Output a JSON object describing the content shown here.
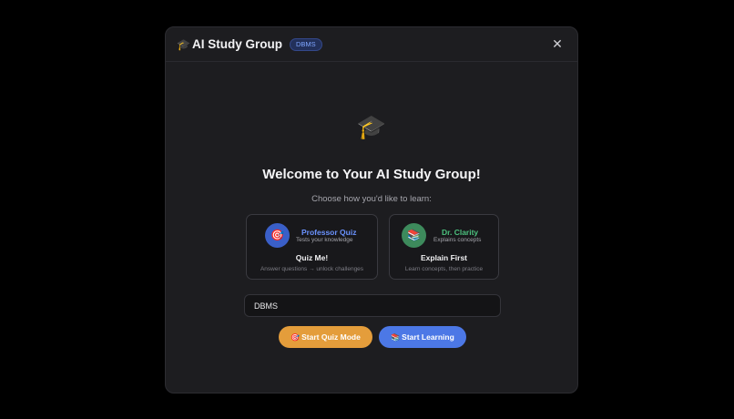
{
  "header": {
    "icon": "🎓",
    "title": "AI Study Group",
    "badge": "DBMS",
    "close_icon": "✕"
  },
  "hero": {
    "icon": "🎓",
    "title": "Welcome to Your AI Study Group!",
    "subtitle": "Choose how you'd like to learn:"
  },
  "modes": {
    "quiz": {
      "avatar": "🎯",
      "persona": "Professor Quiz",
      "persona_desc": "Tests your knowledge",
      "title": "Quiz Me!",
      "desc": "Answer questions → unlock challenges"
    },
    "learn": {
      "avatar": "📚",
      "persona": "Dr. Clarity",
      "persona_desc": "Explains concepts",
      "title": "Explain First",
      "desc": "Learn concepts, then practice"
    }
  },
  "topic_input": {
    "value": "DBMS",
    "placeholder": ""
  },
  "actions": {
    "quiz_icon": "🎯",
    "quiz_label": "Start Quiz Mode",
    "learn_icon": "📚",
    "learn_label": "Start Learning"
  },
  "colors": {
    "accent_blue": "#4c78e6",
    "accent_orange": "#e49d3b",
    "accent_green": "#4cc17e",
    "background": "#000000",
    "modal": "#1d1d20"
  }
}
